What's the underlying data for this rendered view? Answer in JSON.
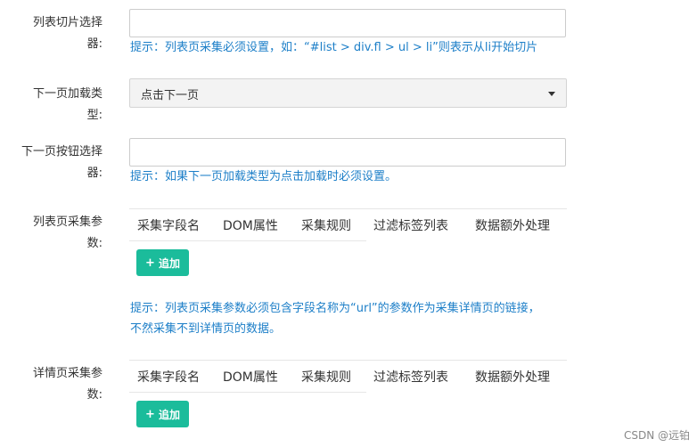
{
  "fields": {
    "list_selector": {
      "label_line1": "列表切片选择",
      "label_line2": "器:",
      "value": "",
      "hint": "提示：列表页采集必须设置，如：“#list > div.fl > ul > li”则表示从li开始切片"
    },
    "next_page_type": {
      "label_line1": "下一页加载类",
      "label_line2": "型:",
      "selected": "点击下一页"
    },
    "next_page_button": {
      "label_line1": "下一页按钮选择",
      "label_line2": "器:",
      "value": "",
      "hint": "提示：如果下一页加载类型为点击加载时必须设置。"
    },
    "list_params": {
      "label_line1": "列表页采集参",
      "label_line2": "数:",
      "columns": [
        "采集字段名",
        "DOM属性",
        "采集规则",
        "过滤标签列表",
        "数据额外处理"
      ],
      "add_label": "追加",
      "hint_line1": "提示：列表页采集参数必须包含字段名称为“url”的参数作为采集详情页的链接，",
      "hint_line2": "不然采集不到详情页的数据。"
    },
    "detail_params": {
      "label_line1": "详情页采集参",
      "label_line2": "数:",
      "columns": [
        "采集字段名",
        "DOM属性",
        "采集规则",
        "过滤标签列表",
        "数据额外处理"
      ],
      "add_label": "追加"
    }
  },
  "watermark": "CSDN @远铂",
  "colors": {
    "accent_button": "#1bbc9b",
    "hint_text": "#1d7fc8"
  }
}
